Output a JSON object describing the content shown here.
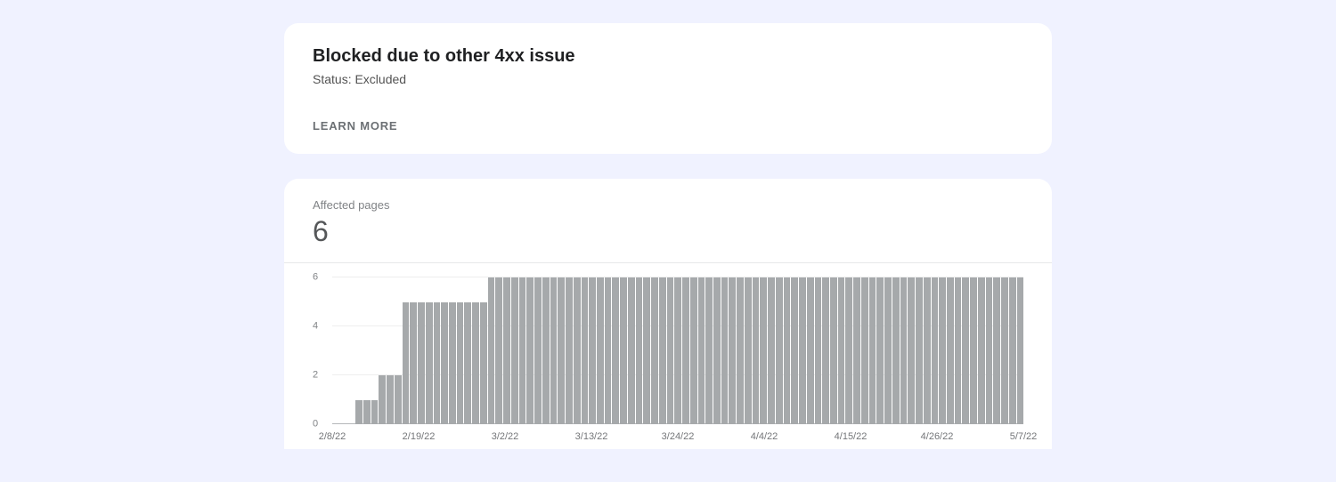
{
  "header": {
    "title": "Blocked due to other 4xx issue",
    "status": "Status: Excluded",
    "learn_more": "LEARN MORE"
  },
  "metric": {
    "label": "Affected pages",
    "value": "6"
  },
  "chart_data": {
    "type": "bar",
    "title": "Affected pages",
    "ylabel": "",
    "xlabel": "",
    "ylim": [
      0,
      6
    ],
    "y_ticks": [
      0,
      2,
      4,
      6
    ],
    "x_ticks": [
      "2/8/22",
      "2/19/22",
      "3/2/22",
      "3/13/22",
      "3/24/22",
      "4/4/22",
      "4/15/22",
      "4/26/22",
      "5/7/22"
    ],
    "categories": [
      "2/8/22",
      "2/9/22",
      "2/10/22",
      "2/11/22",
      "2/12/22",
      "2/13/22",
      "2/14/22",
      "2/15/22",
      "2/16/22",
      "2/17/22",
      "2/18/22",
      "2/19/22",
      "2/20/22",
      "2/21/22",
      "2/22/22",
      "2/23/22",
      "2/24/22",
      "2/25/22",
      "2/26/22",
      "2/27/22",
      "2/28/22",
      "3/1/22",
      "3/2/22",
      "3/3/22",
      "3/4/22",
      "3/5/22",
      "3/6/22",
      "3/7/22",
      "3/8/22",
      "3/9/22",
      "3/10/22",
      "3/11/22",
      "3/12/22",
      "3/13/22",
      "3/14/22",
      "3/15/22",
      "3/16/22",
      "3/17/22",
      "3/18/22",
      "3/19/22",
      "3/20/22",
      "3/21/22",
      "3/22/22",
      "3/23/22",
      "3/24/22",
      "3/25/22",
      "3/26/22",
      "3/27/22",
      "3/28/22",
      "3/29/22",
      "3/30/22",
      "3/31/22",
      "4/1/22",
      "4/2/22",
      "4/3/22",
      "4/4/22",
      "4/5/22",
      "4/6/22",
      "4/7/22",
      "4/8/22",
      "4/9/22",
      "4/10/22",
      "4/11/22",
      "4/12/22",
      "4/13/22",
      "4/14/22",
      "4/15/22",
      "4/16/22",
      "4/17/22",
      "4/18/22",
      "4/19/22",
      "4/20/22",
      "4/21/22",
      "4/22/22",
      "4/23/22",
      "4/24/22",
      "4/25/22",
      "4/26/22",
      "4/27/22",
      "4/28/22",
      "4/29/22",
      "4/30/22",
      "5/1/22",
      "5/2/22",
      "5/3/22",
      "5/4/22",
      "5/5/22",
      "5/6/22",
      "5/7/22"
    ],
    "values": [
      0,
      0,
      0,
      1,
      1,
      1,
      2,
      2,
      2,
      5,
      5,
      5,
      5,
      5,
      5,
      5,
      5,
      5,
      5,
      5,
      6,
      6,
      6,
      6,
      6,
      6,
      6,
      6,
      6,
      6,
      6,
      6,
      6,
      6,
      6,
      6,
      6,
      6,
      6,
      6,
      6,
      6,
      6,
      6,
      6,
      6,
      6,
      6,
      6,
      6,
      6,
      6,
      6,
      6,
      6,
      6,
      6,
      6,
      6,
      6,
      6,
      6,
      6,
      6,
      6,
      6,
      6,
      6,
      6,
      6,
      6,
      6,
      6,
      6,
      6,
      6,
      6,
      6,
      6,
      6,
      6,
      6,
      6,
      6,
      6,
      6,
      6,
      6,
      6
    ]
  }
}
